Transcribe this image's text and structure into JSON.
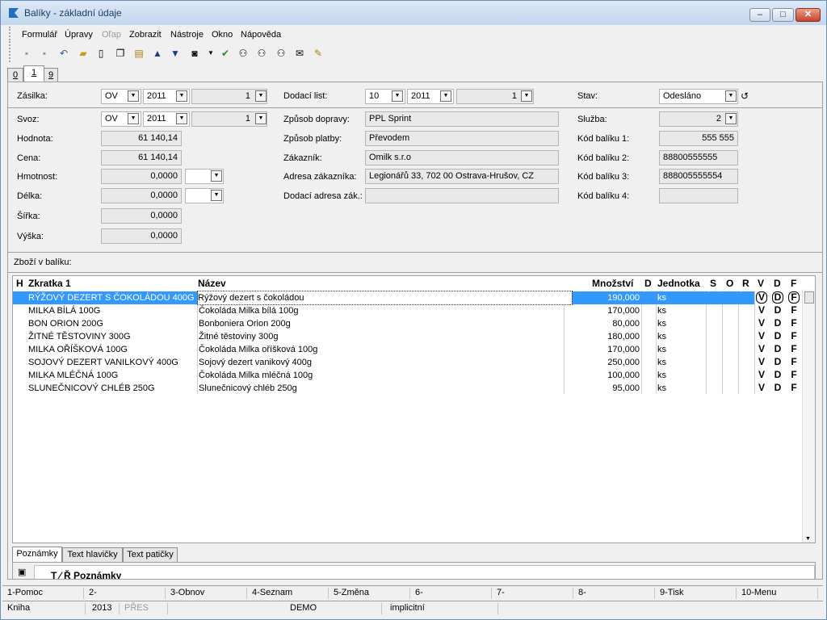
{
  "window": {
    "title": "Balíky - základní údaje"
  },
  "menu": [
    "Formulář",
    "Úpravy",
    "Oľap",
    "Zobrazit",
    "Nástroje",
    "Okno",
    "Nápověda"
  ],
  "tabs_top": [
    "0",
    "1",
    "9"
  ],
  "header": {
    "zasilka_label": "Zásilka:",
    "zasilka_a": "OV",
    "zasilka_b": "2011",
    "zasilka_c": "1",
    "dodaci_label": "Dodací list:",
    "dodaci_a": "10",
    "dodaci_b": "2011",
    "dodaci_c": "1",
    "stav_label": "Stav:",
    "stav_value": "Odesláno"
  },
  "form": {
    "svoz_label": "Svoz:",
    "svoz_a": "OV",
    "svoz_b": "2011",
    "svoz_c": "1",
    "hodnota_label": "Hodnota:",
    "hodnota_value": "61 140,14",
    "cena_label": "Cena:",
    "cena_value": "61 140,14",
    "hmotnost_label": "Hmotnost:",
    "hmotnost_value": "0,0000",
    "delka_label": "Délka:",
    "delka_value": "0,0000",
    "sirka_label": "Šířka:",
    "sirka_value": "0,0000",
    "vyska_label": "Výška:",
    "vyska_value": "0,0000",
    "doprava_label": "Způsob dopravy:",
    "doprava_value": "PPL Sprint",
    "platba_label": "Způsob platby:",
    "platba_value": "Převodem",
    "zakaznik_label": "Zákazník:",
    "zakaznik_value": "Omilk s.r.o",
    "adresa_label": "Adresa zákazníka:",
    "adresa_value": "Legionářů 33, 702 00  Ostrava-Hrušov, CZ",
    "dodaci_adresa_label": "Dodací adresa zák.:",
    "dodaci_adresa_value": "",
    "sluzba_label": "Služba:",
    "sluzba_value": "2",
    "kod1_label": "Kód balíku 1:",
    "kod1_value": "555 555",
    "kod2_label": "Kód balíku 2:",
    "kod2_value": "88800555555",
    "kod3_label": "Kód balíku 3:",
    "kod3_value": "888005555554",
    "kod4_label": "Kód balíku 4:",
    "kod4_value": ""
  },
  "items_label": "Zboží v balíku:",
  "table": {
    "columns": [
      "H",
      "Zkratka 1",
      "Název",
      "Množství",
      "D",
      "Jednotka",
      "S",
      "O",
      "R",
      "V",
      "D",
      "F"
    ],
    "rows": [
      [
        "RÝŽOVÝ DEZERT S ČOKOLÁDOU 400G",
        "Rýžový dezert s čokoládou",
        "190,000",
        "ks"
      ],
      [
        "MILKA BÍLÁ 100G",
        "Čokoláda Milka bílá 100g",
        "170,000",
        "ks"
      ],
      [
        "BON ORION 200G",
        "Bonboniera Orion 200g",
        "80,000",
        "ks"
      ],
      [
        "ŽITNÉ TĚSTOVINY 300G",
        "Žitné těstoviny 300g",
        "180,000",
        "ks"
      ],
      [
        "MILKA OŘÍŠKOVÁ 100G",
        "Čokoláda Milka oříšková 100g",
        "170,000",
        "ks"
      ],
      [
        "SOJOVÝ DEZERT VANILKOVÝ 400G",
        "Sojový dezert vanikový 400g",
        "250,000",
        "ks"
      ],
      [
        "MILKA MLÉČNÁ 100G",
        "Čokoláda Milka mléčná 100g",
        "100,000",
        "ks"
      ],
      [
        "SLUNEČNICOVÝ CHLÉB 250G",
        "Slunečnicový chléb 250g",
        "95,000",
        "ks"
      ]
    ],
    "flags": [
      "V",
      "D",
      "F"
    ]
  },
  "bottom_tabs": [
    "Poznámky",
    "Text hlavičky",
    "Text patičky"
  ],
  "notes_header": "T    ⁄  Ř  Poznámky",
  "fkeys": [
    "1-Pomoc",
    "2-",
    "3-Obnov",
    "4-Seznam",
    "5-Změna",
    "6-",
    "7-",
    "8-",
    "9-Tisk",
    "10-Menu"
  ],
  "status": {
    "book": "Kniha",
    "year": "2013",
    "mode": "PŘES",
    "db": "DEMO",
    "profile": "implicitní"
  },
  "colors": {
    "selected_row": "#3399ff",
    "accent": "#1e395b"
  }
}
